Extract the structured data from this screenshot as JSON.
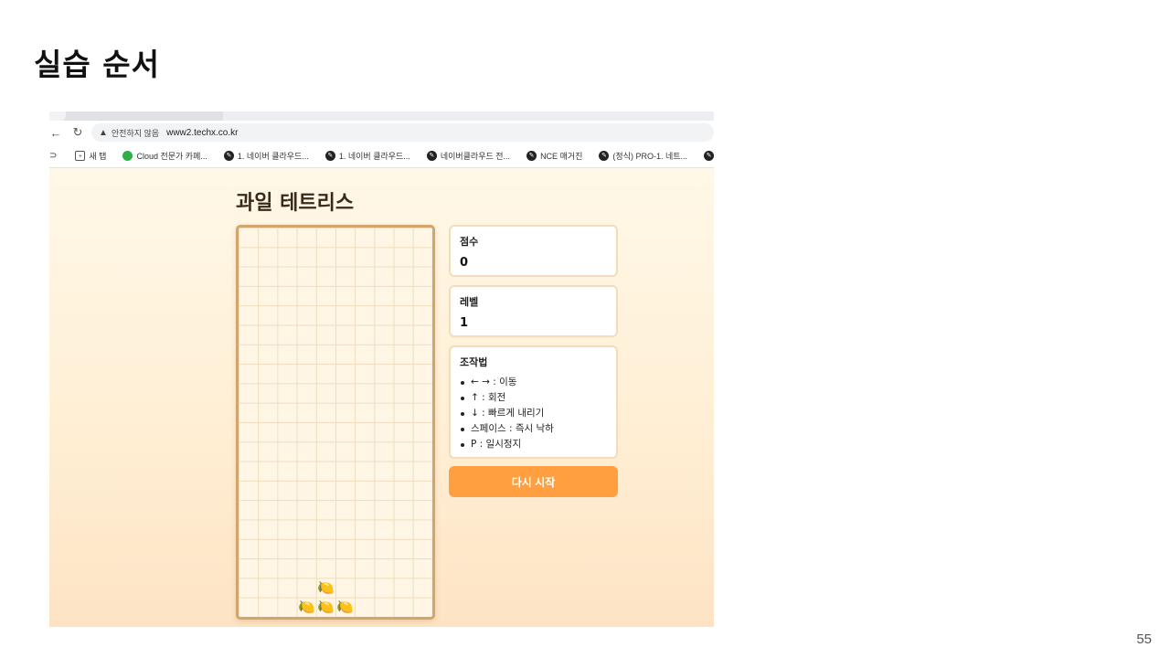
{
  "slide": {
    "title": "실습 순서",
    "page_number": "55"
  },
  "browser": {
    "security_label": "안전하지 않음",
    "url": "www2.techx.co.kr",
    "bookmarks": [
      {
        "icon": "new-tab-icon",
        "label": "새 탭"
      },
      {
        "icon": "cloud-icon",
        "label": "Cloud 전문가 카페..."
      },
      {
        "icon": "bookmark-icon",
        "label": "1. 네이버 클라우드..."
      },
      {
        "icon": "bookmark-icon",
        "label": "1. 네이버 클라우드..."
      },
      {
        "icon": "bookmark-icon",
        "label": "네이버클라우드 전..."
      },
      {
        "icon": "bookmark-icon",
        "label": "NCE 매거진"
      },
      {
        "icon": "bookmark-icon",
        "label": "(정식) PRO-1. 네트..."
      },
      {
        "icon": "bookmark-icon",
        "label": "N"
      }
    ]
  },
  "game": {
    "title": "과일 테트리스",
    "score_label": "점수",
    "score_value": "0",
    "level_label": "레벨",
    "level_value": "1",
    "controls_label": "조작법",
    "controls": [
      "← → : 이동",
      "↑ : 회전",
      "↓ : 빠르게 내리기",
      "스페이스 : 즉시 낙하",
      "P : 일시정지"
    ],
    "restart_label": "다시 시작",
    "piece_glyph": "🍋",
    "colors": {
      "accent": "#ff9f3f",
      "board_border": "#d2a56c",
      "panel_border": "#f3ddb8"
    }
  }
}
